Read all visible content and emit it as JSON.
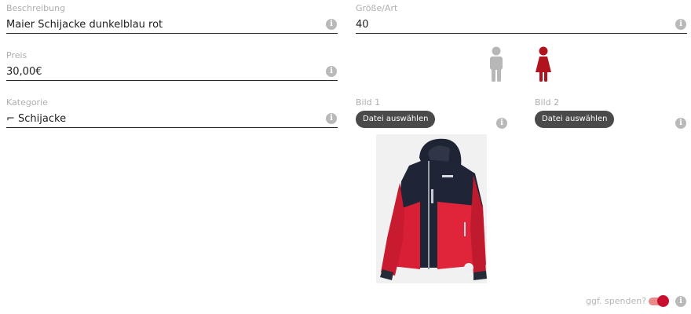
{
  "form": {
    "description": {
      "label": "Beschreibung",
      "value": "Maier Schijacke dunkelblau rot"
    },
    "price": {
      "label": "Preis",
      "value": "30,00€"
    },
    "category": {
      "label": "Kategorie",
      "value": "⌐ Schijacke"
    },
    "size": {
      "label": "Größe/Art",
      "value": "40"
    }
  },
  "gender": {
    "male": {
      "icon": "male-person-icon",
      "color": "#b7b7b7",
      "selected": false
    },
    "female": {
      "icon": "female-person-icon",
      "color": "#b0121e",
      "selected": true
    }
  },
  "images": {
    "image1": {
      "label": "Bild 1",
      "button": "Datei auswählen"
    },
    "image2": {
      "label": "Bild 2",
      "button": "Datei auswählen"
    }
  },
  "donate": {
    "label": "ggf. spenden?",
    "enabled": true
  },
  "info_icon": {
    "glyph": "i"
  },
  "colors": {
    "accent": "#c8102e",
    "toggle_track": "#e98b8b",
    "info": "#b9b9b9",
    "button": "#4a4a4a"
  }
}
